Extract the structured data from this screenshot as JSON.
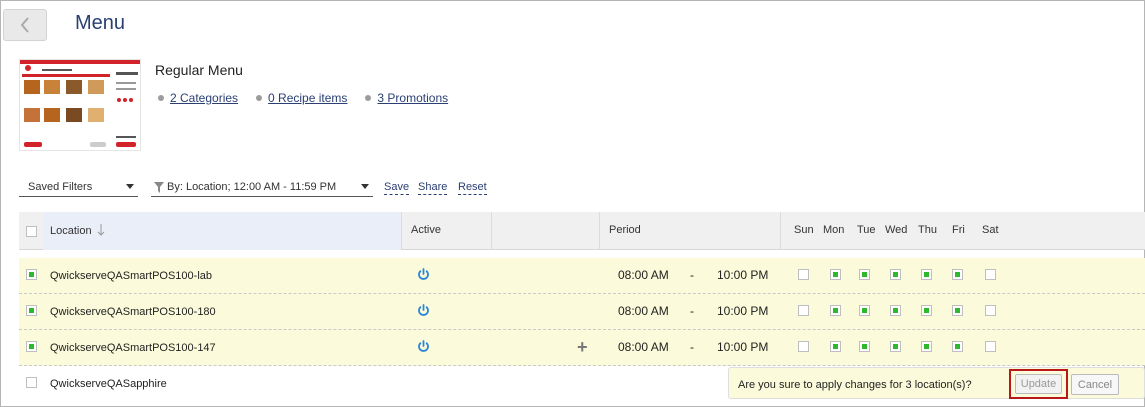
{
  "page": {
    "title": "Menu",
    "back_icon": "chevron-left-icon"
  },
  "menu": {
    "name": "Regular Menu",
    "links": [
      {
        "label": "2 Categories"
      },
      {
        "label": "0 Recipe items"
      },
      {
        "label": "3 Promotions"
      }
    ]
  },
  "filters": {
    "saved_filters": "Saved Filters",
    "by_filter": "By: Location; 12:00 AM - 11:59 PM",
    "save": "Save",
    "share": "Share",
    "reset": "Reset"
  },
  "table": {
    "headers": {
      "location": "Location",
      "active": "Active",
      "period": "Period"
    },
    "days": [
      "Sun",
      "Mon",
      "Tue",
      "Wed",
      "Thu",
      "Fri",
      "Sat"
    ],
    "period_separator": "-",
    "rows": [
      {
        "location": "QwickserveQASmartPOS100-lab",
        "selected": true,
        "start": "08:00 AM",
        "end": "10:00 PM",
        "days": [
          false,
          true,
          true,
          true,
          true,
          true,
          false
        ]
      },
      {
        "location": "QwickserveQASmartPOS100-180",
        "selected": true,
        "start": "08:00 AM",
        "end": "10:00 PM",
        "days": [
          false,
          true,
          true,
          true,
          true,
          true,
          false
        ]
      },
      {
        "location": "QwickserveQASmartPOS100-147",
        "selected": true,
        "start": "08:00 AM",
        "end": "10:00 PM",
        "days": [
          false,
          true,
          true,
          true,
          true,
          true,
          false
        ]
      },
      {
        "location": "QwickserveQASapphire",
        "selected": false
      }
    ]
  },
  "confirm": {
    "message": "Are you sure to apply changes for 3 location(s)?",
    "update": "Update",
    "cancel": "Cancel"
  },
  "colors": {
    "accent": "#2a3f72",
    "check": "#2eb82e",
    "power": "#2b86d9",
    "highlight": "#fbfbdb",
    "danger": "#b81818"
  }
}
